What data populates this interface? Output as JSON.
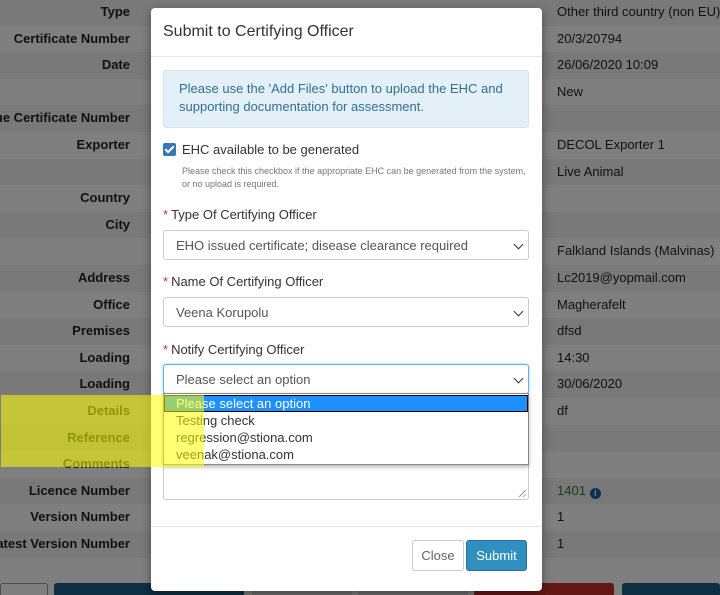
{
  "background": {
    "rows": [
      {
        "label": "Type",
        "value": "Other third country (non EU)"
      },
      {
        "label": "Certificate Number",
        "value": "20/3/20794"
      },
      {
        "label": "Date",
        "value": "26/06/2020 10:09"
      },
      {
        "label": "",
        "value": "New"
      },
      {
        "label": "Unique Certificate Number",
        "value": ""
      },
      {
        "label": "Exporter",
        "value": "DECOL Exporter 1"
      },
      {
        "label": "",
        "value": "Live Animal"
      },
      {
        "label": "Country",
        "value": ""
      },
      {
        "label": "City",
        "value": ""
      },
      {
        "label": "",
        "value": "Falkland Islands (Malvinas)"
      },
      {
        "label": "Address",
        "value": "Lc2019@yopmail.com"
      },
      {
        "label": "Office",
        "value": "Magherafelt"
      },
      {
        "label": "Premises",
        "value": "dfsd"
      },
      {
        "label": "Loading",
        "value": "14:30"
      },
      {
        "label": "Loading",
        "value": "30/06/2020"
      },
      {
        "label": "Details",
        "value": "df"
      },
      {
        "label": "Reference",
        "value": ""
      },
      {
        "label": "Comments",
        "value": ""
      },
      {
        "label": "Licence Number",
        "value": "1401"
      },
      {
        "label": "Version Number",
        "value": "1"
      },
      {
        "label": "Latest Version Number",
        "value": "1"
      }
    ]
  },
  "modal": {
    "title": "Submit to Certifying Officer",
    "alert_text": "Please use the 'Add Files' button to upload the EHC and supporting documentation for assessment.",
    "ehc_checkbox": {
      "label": "EHC available to be generated",
      "checked": true,
      "help": "Please check this checkbox if the appropriate EHC can be generated from the system, or no upload is required."
    },
    "type_field": {
      "label": "Type Of Certifying Officer",
      "required_mark": "*",
      "value": "EHO issued certificate; disease clearance required"
    },
    "name_field": {
      "label": "Name Of Certifying Officer",
      "required_mark": "*",
      "value": "Veena Korupolu"
    },
    "notify_field": {
      "label": "Notify Certifying Officer",
      "required_mark": "*",
      "value": "Please select an option",
      "options": [
        "Please select an option",
        "Testing check",
        "regression@stiona.com",
        "veenak@stiona.com"
      ],
      "selected_index": 0
    },
    "close_label": "Close",
    "submit_label": "Submit"
  },
  "colors": {
    "accent": "#2f8fbf",
    "dropdown_selected": "#1e90ff",
    "highlight": "#ffff00",
    "alert_bg": "#e3f0f7"
  }
}
